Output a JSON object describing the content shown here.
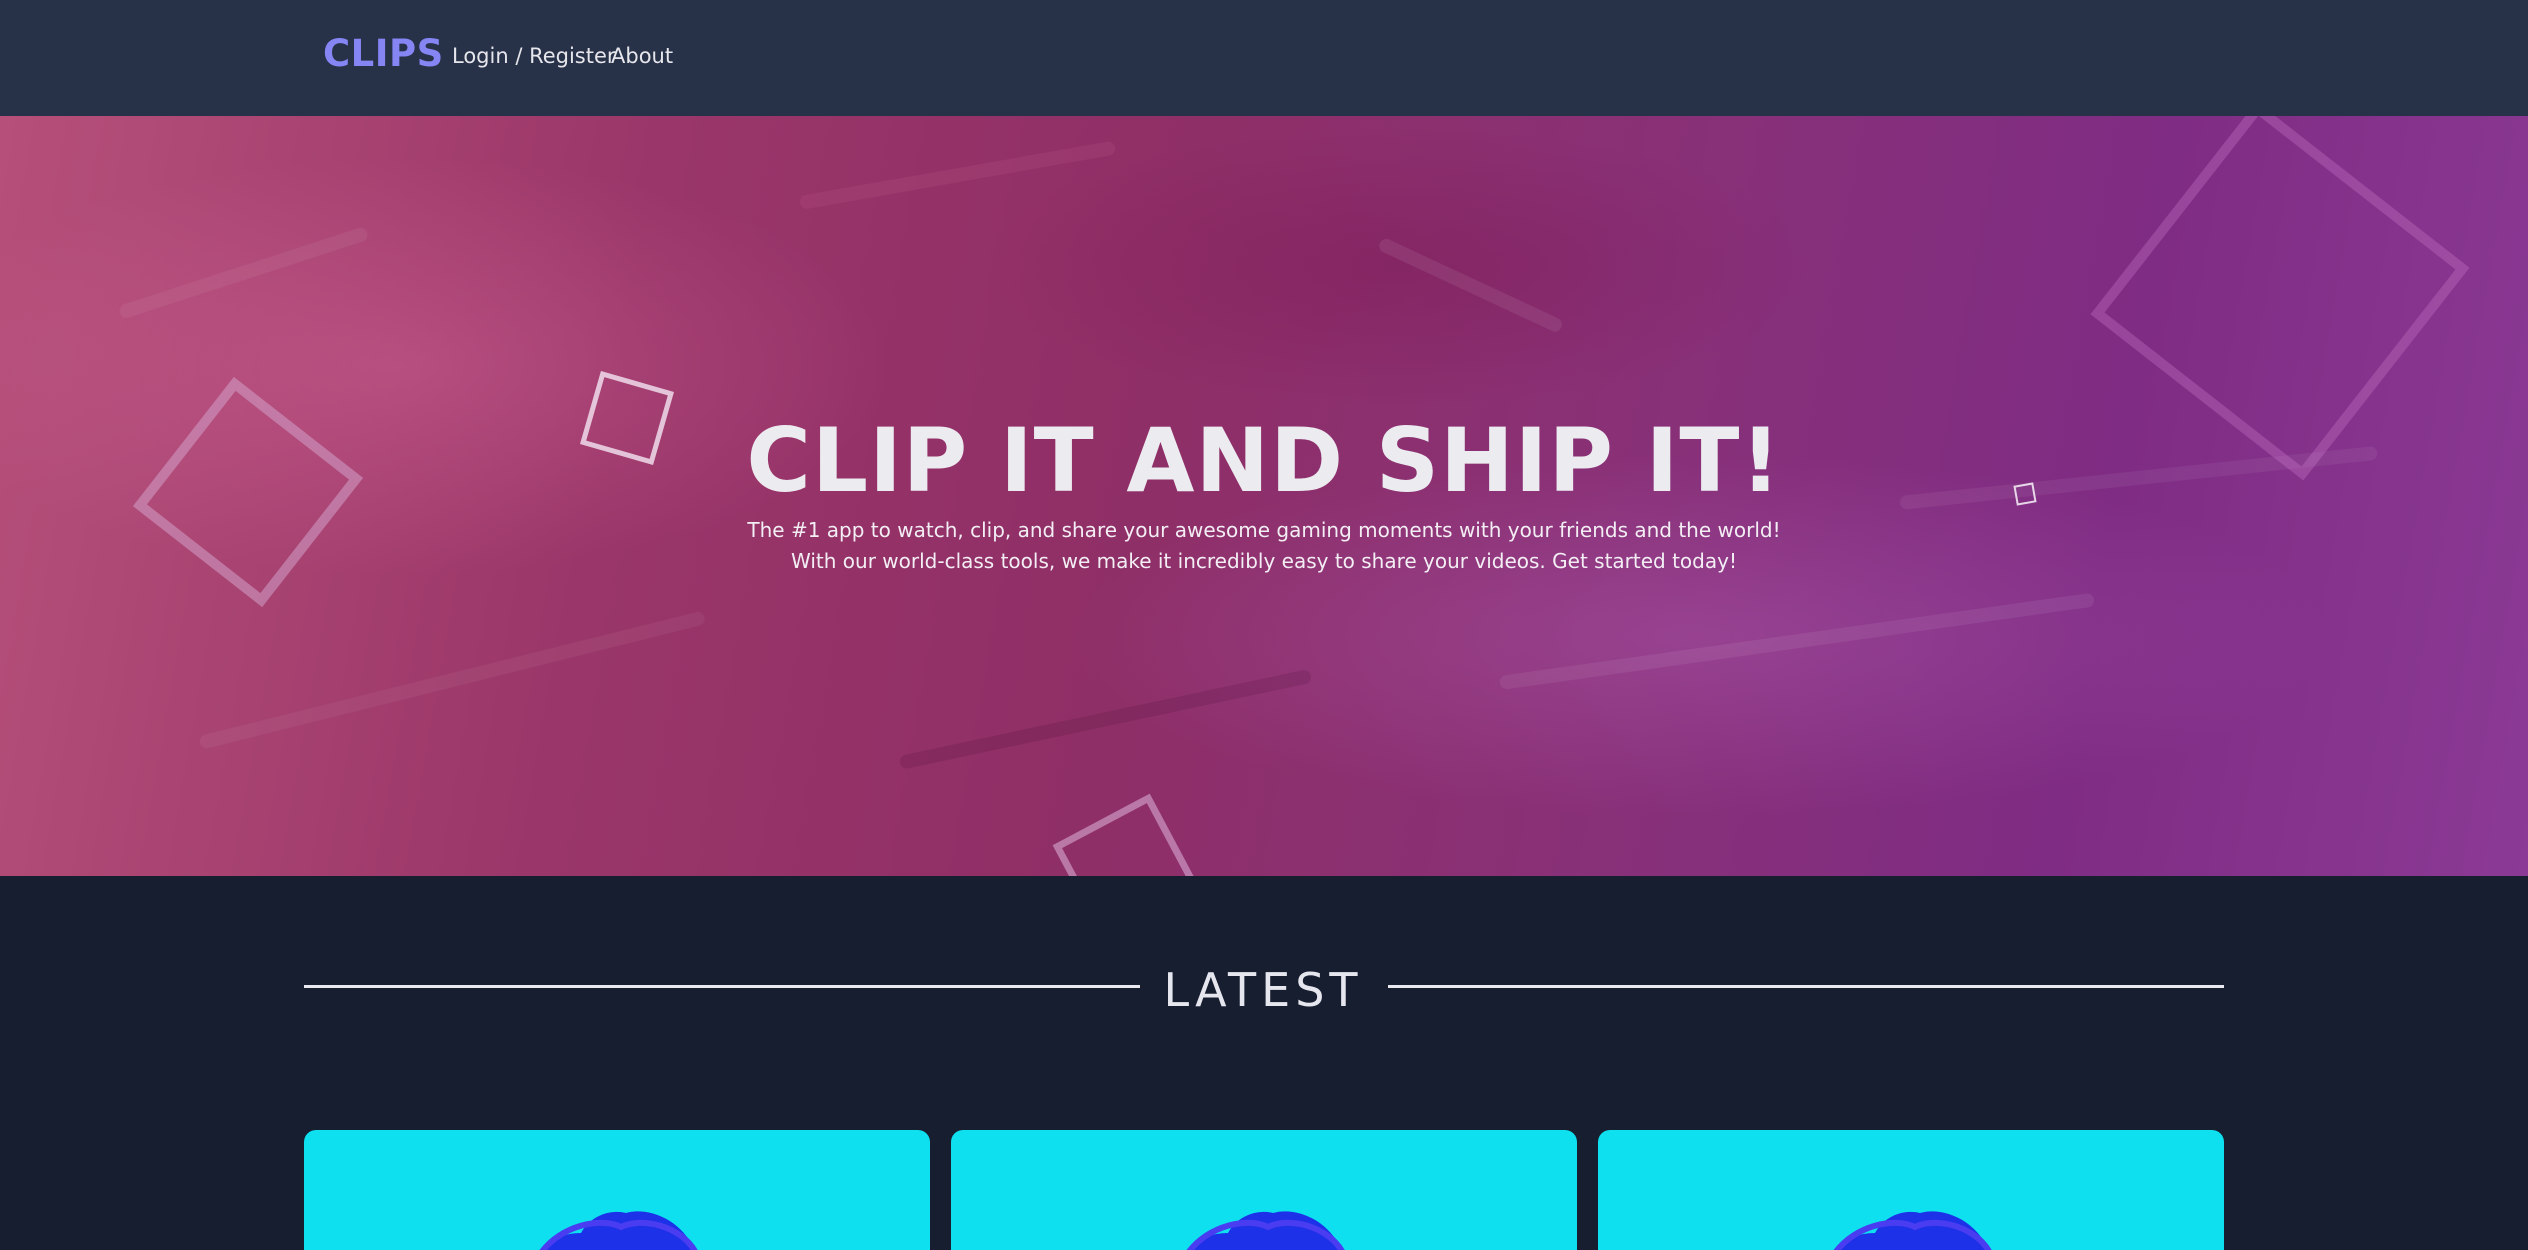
{
  "nav": {
    "brand": "CLIPS",
    "links": [
      {
        "label": "Login / Register"
      },
      {
        "label": "About"
      }
    ]
  },
  "hero": {
    "title": "CLIP IT AND SHIP IT!",
    "text": "The #1 app to watch, clip, and share your awesome gaming moments with your friends and the world! With our world-class tools, we make it incredibly easy to share your videos. Get started today!"
  },
  "latest": {
    "title": "LATEST"
  },
  "colors": {
    "nav_bg": "#273147",
    "page_bg": "#171e30",
    "brand": "#8685f4",
    "card_bg": "#0ee0ef",
    "card_blob": "#1d31e8"
  }
}
